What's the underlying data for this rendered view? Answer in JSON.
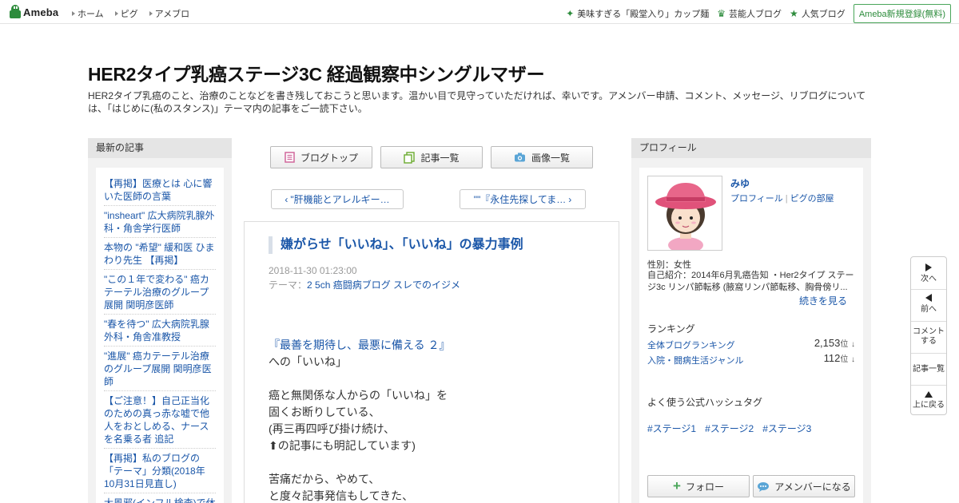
{
  "topbar": {
    "logo_text": "Ameba",
    "nav": [
      {
        "label": "ホーム"
      },
      {
        "label": "ピグ"
      },
      {
        "label": "アメブロ"
      }
    ],
    "right": [
      {
        "label": "美味すぎる「殿堂入り」カップ麺",
        "icon": "sparkle-icon"
      },
      {
        "label": "芸能人ブログ",
        "icon": "crown-icon"
      },
      {
        "label": "人気ブログ",
        "icon": "star-icon"
      }
    ],
    "signup_label": "Ameba新規登録(無料)"
  },
  "blog": {
    "title": "HER2タイプ乳癌ステージ3C 経過観察中シングルマザー",
    "description": "HER2タイプ乳癌のこと、治療のことなどを書き残しておこうと思います。温かい目で見守っていただければ、幸いです。アメンバー申請、コメント、メッセージ、リブログについては、「はじめに(私のスタンス)」テーマ内の記事をご一読下さい。"
  },
  "left_sidebar": {
    "heading": "最新の記事",
    "items": [
      {
        "label": "【再掲】医療とは 心に響いた医師の言葉"
      },
      {
        "label": "\"insheart\" 広大病院乳腺外科・角舎学行医師"
      },
      {
        "label": "本物の \"希望\" 緩和医 ひまわり先生 【再掲】"
      },
      {
        "label": "\"この１年で変わる\" 癌カテーテル治療のグループ展開 関明彦医師"
      },
      {
        "label": "\"春を待つ\" 広大病院乳腺外科・角舎准教授"
      },
      {
        "label": "\"進展\" 癌カテーテル治療のグループ展開 関明彦医師"
      },
      {
        "label": "【ご注意！】自己正当化のための真っ赤な嘘で他人をおとしめる、ナースを名乗る者 追記"
      },
      {
        "label": "【再掲】私のブログの「テーマ」分類(2018年10月31日見直し)"
      },
      {
        "label": "大風邪(インフル検査)で休"
      }
    ]
  },
  "toolbar": {
    "blog_top": "ブログトップ",
    "article_list": "記事一覧",
    "image_list": "画像一覧"
  },
  "pager": {
    "prev": "\"肝機能とアレルギー…",
    "next": "\"\"『永住先探してま…"
  },
  "article": {
    "title": "嫌がらせ「いいね」、「いいね」の暴力事例",
    "date": "2018-11-30 01:23:00",
    "theme_prefix": "テーマ：",
    "theme": "2 5ch 癌闘病ブログ スレでのイジメ",
    "lines": [
      {
        "text": "『最善を期待し、最悪に備える ２』",
        "link": true
      },
      {
        "text": "への「いいね」",
        "link": false
      },
      {
        "text": "",
        "link": false
      },
      {
        "text": "癌と無関係な人からの「いいね」を",
        "link": false
      },
      {
        "text": "固くお断りしている、",
        "link": false
      },
      {
        "text": "(再三再四呼び掛け続け、",
        "link": false
      },
      {
        "text": "⬆の記事にも明記しています)",
        "link": false
      },
      {
        "text": "",
        "link": false
      },
      {
        "text": "苦痛だから、やめて、",
        "link": false
      },
      {
        "text": "と度々記事発信もしてきた、",
        "link": false
      }
    ]
  },
  "profile": {
    "heading": "プロフィール",
    "name": "みゆ",
    "link_profile": "プロフィール",
    "link_pig": "ピグの部屋",
    "attr": "性別：女性",
    "intro": "自己紹介：2014年6月乳癌告知 ・Her2タイプ ステージ3c リンパ節転移 (腋窩リンパ節転移、胸骨傍リ...",
    "more": "続きを見る",
    "ranking_title": "ランキング",
    "rankings": [
      {
        "label": "全体ブログランキング",
        "value": "2,153",
        "unit": "位",
        "arrow": "↓"
      },
      {
        "label": "入院・闘病生活ジャンル",
        "value": "112",
        "unit": "位",
        "arrow": "↓"
      }
    ],
    "hashtag_title": "よく使う公式ハッシュタグ",
    "hashtags": [
      "#ステージ1",
      "#ステージ2",
      "#ステージ3"
    ],
    "follow_label": "フォロー",
    "amember_label": "アメンバーになる"
  },
  "floatnav": {
    "next": "次へ",
    "prev": "前へ",
    "comment_1": "コメント",
    "comment_2": "する",
    "articles": "記事一覧",
    "top": "上に戻る"
  },
  "colors": {
    "link": "#1a56a8",
    "brand": "#2d8c3c",
    "sidebar_bg": "#f2f2f2"
  }
}
